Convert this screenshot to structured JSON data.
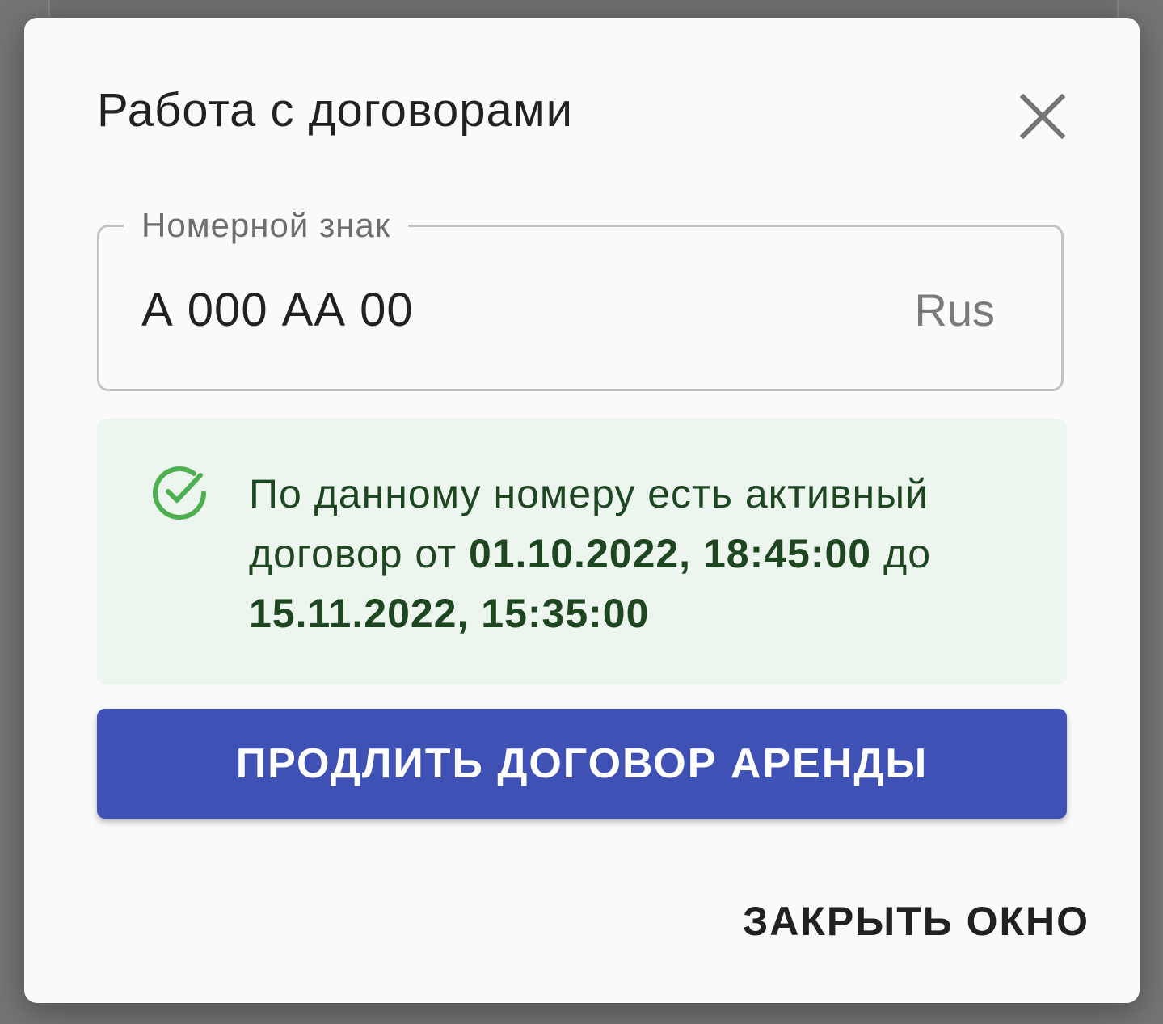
{
  "dialog": {
    "title": "Работа с договорами",
    "close_icon": "close-icon"
  },
  "plate_field": {
    "label": "Номерной знак",
    "value": "А 000 АА 00",
    "suffix": "Rus"
  },
  "alert": {
    "icon": "check-circle-icon",
    "text_prefix": "По данному номеру есть активный договор от ",
    "date_from": "01.10.2022, 18:45:00",
    "text_middle": " до ",
    "date_to": "15.11.2022, 15:35:00",
    "color": "#1e4620",
    "background": "#edf6ee",
    "icon_color": "#4caf50"
  },
  "actions": {
    "extend_label": "ПРОДЛИТЬ ДОГОВОР АРЕНДЫ",
    "extend_color": "#3f51b5",
    "close_label": "ЗАКРЫТЬ ОКНО"
  }
}
